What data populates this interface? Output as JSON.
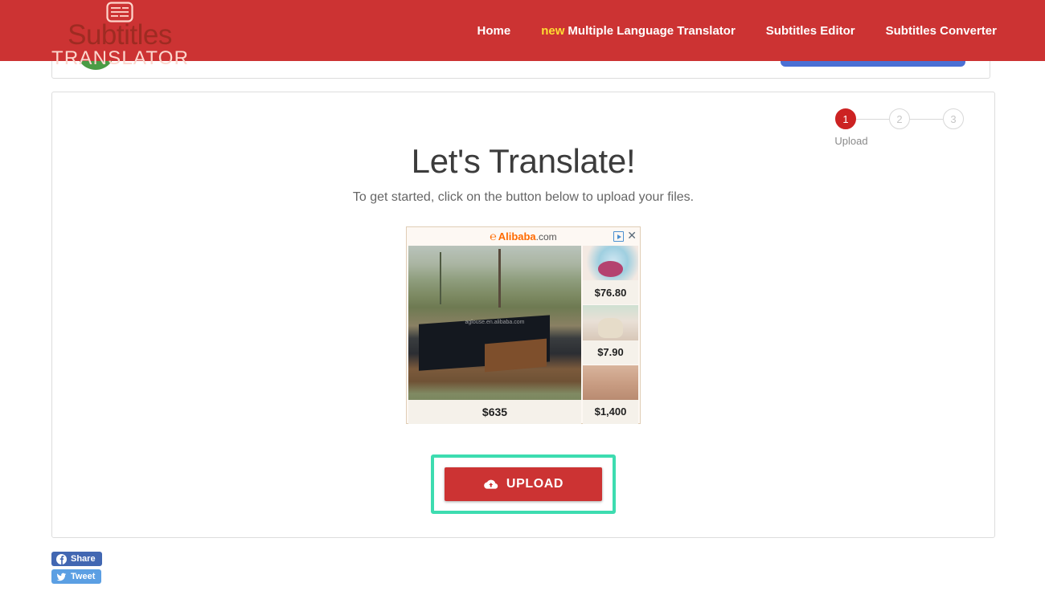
{
  "header": {
    "background_color": "#cc3333",
    "logo": {
      "icon": "subtitles-icon",
      "line1": "Subtitles",
      "line2": "TRANSLATOR"
    },
    "nav": [
      {
        "label": "Home",
        "badge": ""
      },
      {
        "label": "Multiple Language Translator",
        "badge": "new"
      },
      {
        "label": "Subtitles Editor",
        "badge": ""
      },
      {
        "label": "Subtitles Converter",
        "badge": ""
      }
    ]
  },
  "stepper": {
    "steps": [
      {
        "number": "1",
        "label": "Upload",
        "state": "active"
      },
      {
        "number": "2",
        "label": "",
        "state": "inactive"
      },
      {
        "number": "3",
        "label": "",
        "state": "inactive"
      }
    ],
    "active_color": "#cc2222",
    "inactive_color": "#c6c6c6"
  },
  "hero": {
    "title": "Let's Translate!",
    "subtitle": "To get started, click on the button below to upload your files."
  },
  "ad": {
    "brand_mark": "℮",
    "brand_name": "Alibaba",
    "brand_tld": ".com",
    "adchoices_icon": "adchoices-icon",
    "close_icon": "close-icon",
    "main": {
      "watermark": "aglouse.en.alibaba.com",
      "price": "$635"
    },
    "side": [
      {
        "price": "$76.80"
      },
      {
        "price": "$7.90"
      },
      {
        "price": "$1,400"
      }
    ]
  },
  "upload": {
    "label": "UPLOAD",
    "icon": "cloud-upload-icon",
    "button_color": "#cc3333",
    "focus_outline_color": "#3ddcb0"
  },
  "social": {
    "facebook": {
      "label": "Share",
      "icon": "facebook-icon",
      "color": "#4267b2"
    },
    "twitter": {
      "label": "Tweet",
      "icon": "twitter-icon",
      "color": "#5b9fe3"
    }
  }
}
